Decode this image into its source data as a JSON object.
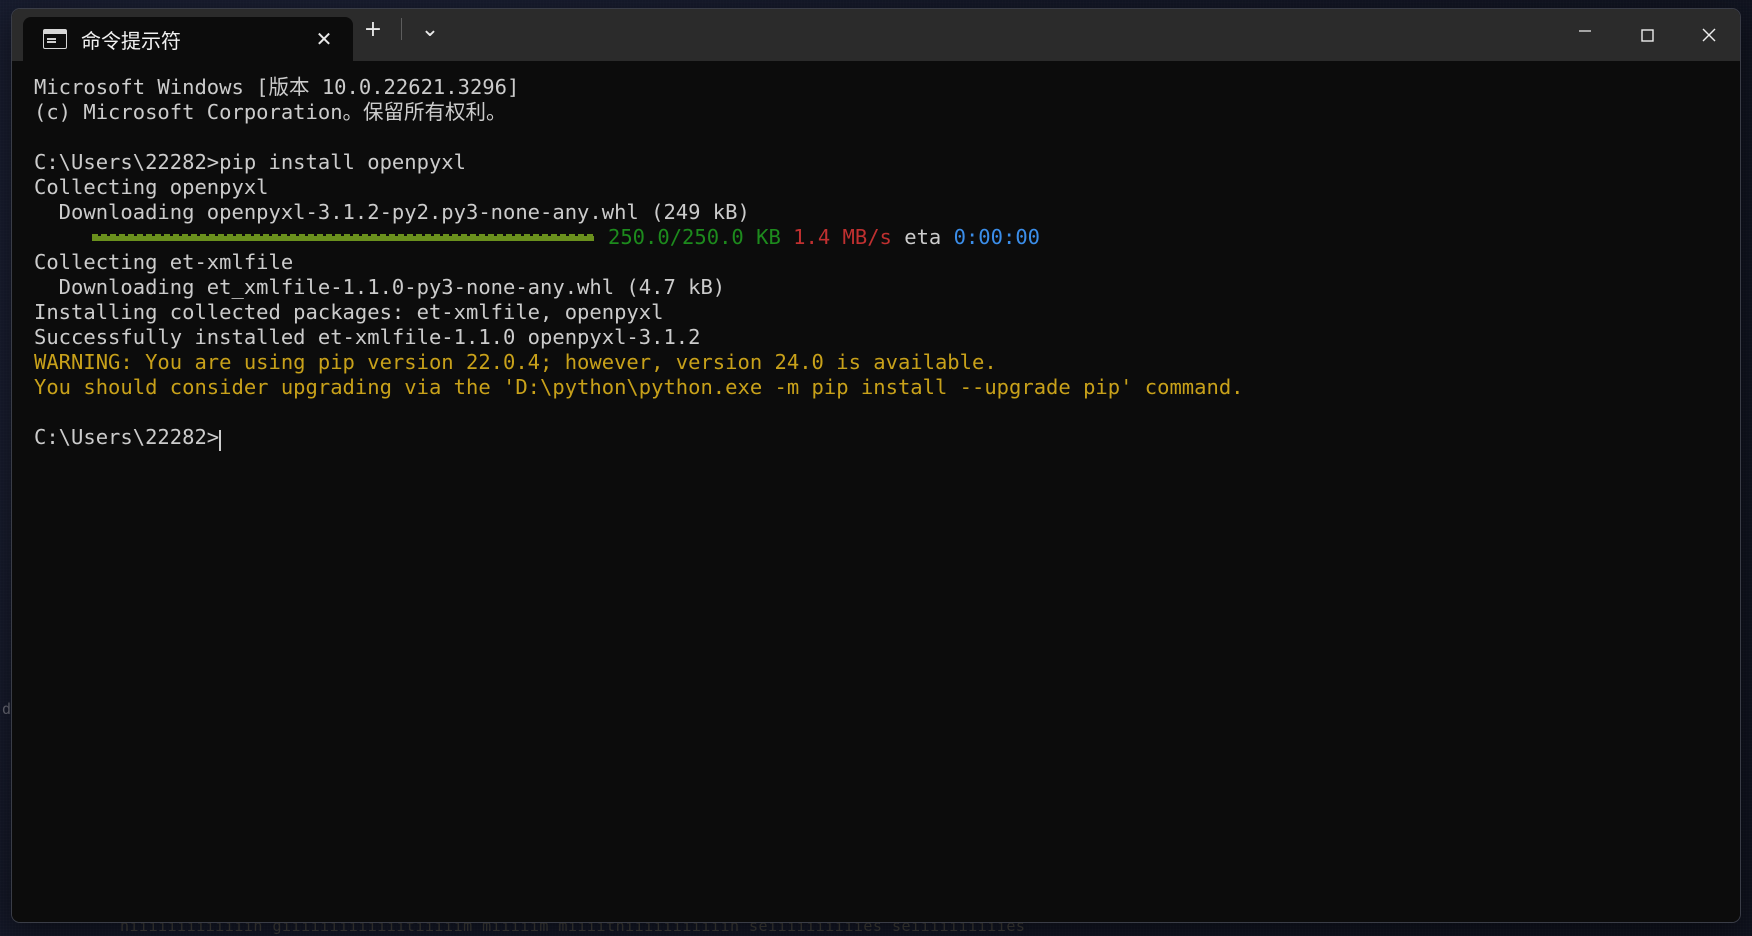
{
  "window": {
    "tab": {
      "title": "命令提示符",
      "icon": "console-icon",
      "close_label": "✕"
    },
    "new_tab_label": "+",
    "dropdown_label": "⌄",
    "controls": {
      "minimize_label": "—",
      "maximize_label": "▢",
      "close_label": "✕"
    }
  },
  "desktop": {
    "bottom_text": "hiiiiiiiiiiiiih  giiiiiiiiiiiiitiiiiim  miiiiim  miiiithiiiiiiiiiiih  seiiiiiiiiiies  seiiiiiiiiiies",
    "left_char": "d"
  },
  "terminal": {
    "colors": {
      "background": "#0c0c0c",
      "foreground": "#cccccc",
      "green": "#1d8b1d",
      "red": "#c03030",
      "blue": "#3b8eea",
      "yellow": "#c8a11a",
      "progress_bar": "#6a901d"
    },
    "lines": [
      {
        "id": "l1",
        "text": "Microsoft Windows [版本 10.0.22621.3296]"
      },
      {
        "id": "l2",
        "text": "(c) Microsoft Corporation。保留所有权利。"
      },
      {
        "id": "l3",
        "text": ""
      },
      {
        "id": "l4",
        "text": "C:\\Users\\22282>pip install openpyxl"
      },
      {
        "id": "l5",
        "text": "Collecting openpyxl"
      },
      {
        "id": "l6",
        "text": "  Downloading openpyxl-3.1.2-py2.py3-none-any.whl (249 kB)"
      },
      {
        "id": "l7",
        "text": "",
        "type": "progress"
      },
      {
        "id": "l8",
        "text": "Collecting et-xmlfile"
      },
      {
        "id": "l9",
        "text": "  Downloading et_xmlfile-1.1.0-py3-none-any.whl (4.7 kB)"
      },
      {
        "id": "l10",
        "text": "Installing collected packages: et-xmlfile, openpyxl"
      },
      {
        "id": "l11",
        "text": "Successfully installed et-xmlfile-1.1.0 openpyxl-3.1.2"
      },
      {
        "id": "l12",
        "text": "WARNING: You are using pip version 22.0.4; however, version 24.0 is available."
      },
      {
        "id": "l13",
        "text": "You should consider upgrading via the 'D:\\python\\python.exe -m pip install --upgrade pip' command."
      },
      {
        "id": "l14",
        "text": ""
      },
      {
        "id": "l15",
        "text": "C:\\Users\\22282>"
      }
    ],
    "progress": {
      "size": "250.0/250.0 KB",
      "speed": "1.4 MB/s",
      "eta_label": "eta",
      "eta_value": "0:00:00",
      "percent": 100
    },
    "prompt": "C:\\Users\\22282>"
  }
}
